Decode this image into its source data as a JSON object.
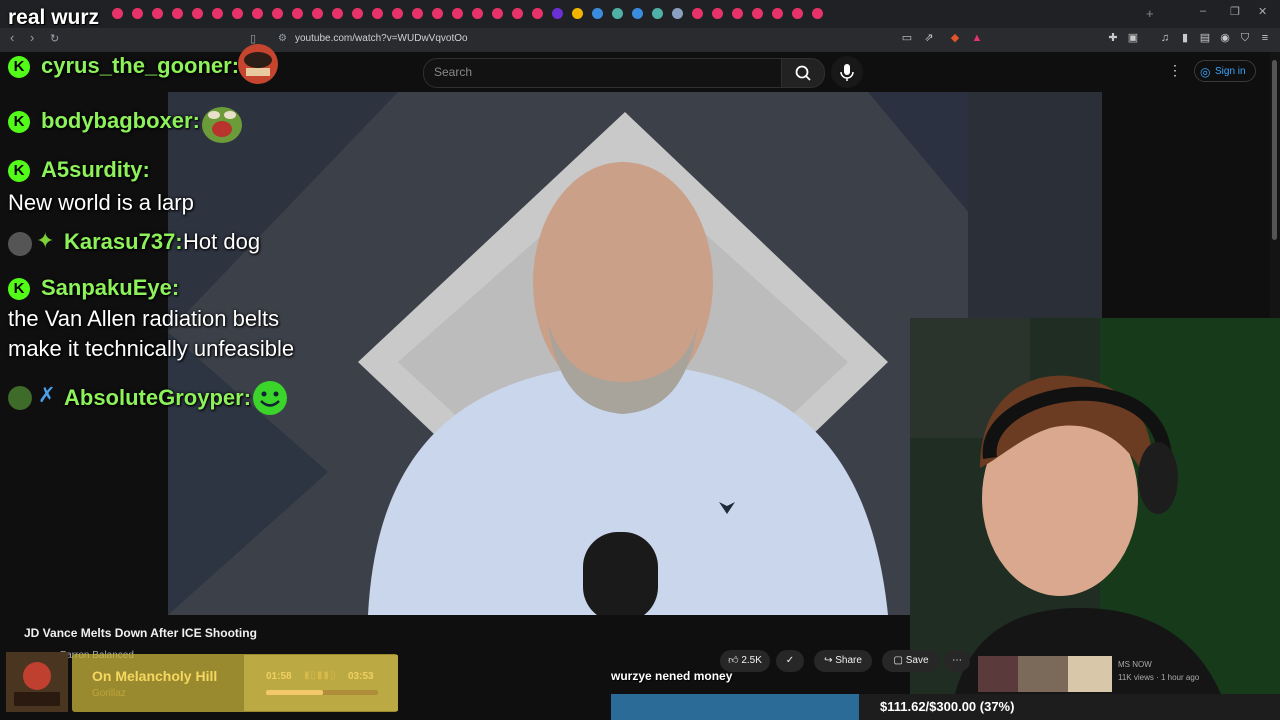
{
  "stream": {
    "title": "real wurz"
  },
  "browser": {
    "url": "youtube.com/watch?v=WUDwVqvotOo",
    "tab_colors": [
      "#e8336a",
      "#e8336a",
      "#e8336a",
      "#e8336a",
      "#e8336a",
      "#e8336a",
      "#e8336a",
      "#e8336a",
      "#e8336a",
      "#e8336a",
      "#e8336a",
      "#e8336a",
      "#e8336a",
      "#e8336a",
      "#e8336a",
      "#e8336a",
      "#e8336a",
      "#e8336a",
      "#e8336a",
      "#e8336a",
      "#e8336a",
      "#e8336a",
      "#6b2fd6",
      "#f2b400",
      "#3a8dde",
      "#4fb0a6",
      "#3a8dde",
      "#4fb0a6",
      "#8aa0c0",
      "#e8336a",
      "#e8336a",
      "#e8336a",
      "#e8336a",
      "#e8336a",
      "#e8336a",
      "#e8336a"
    ]
  },
  "youtube": {
    "search_placeholder": "Search",
    "sign_in": "Sign in",
    "video_title": "JD Vance Melts Down After ICE Shooting",
    "channel": "Farron Balanced",
    "likes": "2.5K",
    "share": "Share",
    "save": "Save",
    "rec_channel": "MS NOW",
    "rec_meta": "11K views · 1 hour ago"
  },
  "chat": [
    {
      "user": "cyrus_the_gooner:",
      "message": "",
      "badge": "kick",
      "color": "#8df15a"
    },
    {
      "user": "bodybagboxer:",
      "message": "",
      "badge": "kick",
      "color": "#8df15a"
    },
    {
      "user": "A5surdity:",
      "message": "New world is a larp",
      "badge": "kick",
      "color": "#8df15a"
    },
    {
      "user": "Karasu737:",
      "message": "Hot dog",
      "badge": "avatar",
      "color": "#8df15a"
    },
    {
      "user": "SanpakuEye:",
      "message": "the Van Allen radiation belts",
      "message2": "make it technically unfeasible",
      "badge": "kick",
      "color": "#8df15a"
    },
    {
      "user": "AbsoluteGroyper:",
      "message": "",
      "badge": "avatar",
      "color": "#8df15a"
    }
  ],
  "music": {
    "song": "On Melancholy Hill",
    "artist": "Gorillaz",
    "elapsed": "01:58",
    "total": "03:53",
    "progress": 0.51
  },
  "tts": {
    "text": "wurzye nened money"
  },
  "goal": {
    "text": "$111.62/$300.00 (37%)",
    "progress": 0.37,
    "color": "#2a6b98"
  }
}
